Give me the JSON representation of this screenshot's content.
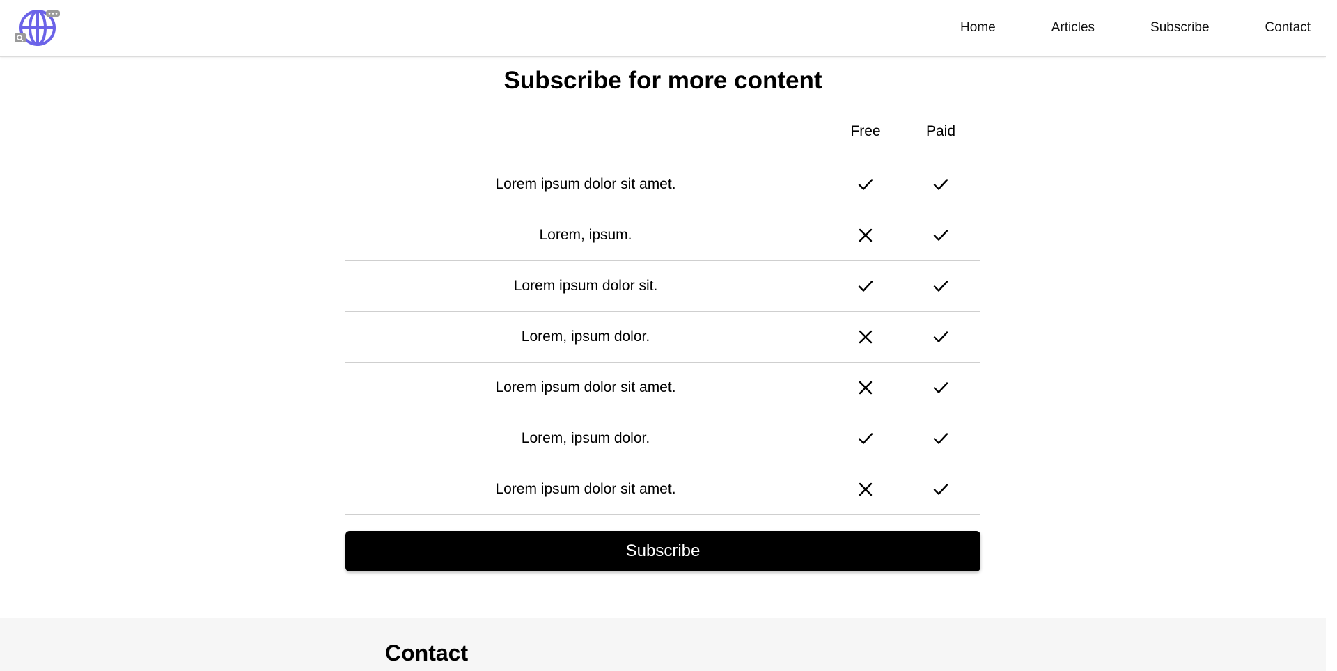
{
  "nav": {
    "items": [
      {
        "label": "Home"
      },
      {
        "label": "Articles"
      },
      {
        "label": "Subscribe"
      },
      {
        "label": "Contact"
      }
    ]
  },
  "logo": {
    "icon": "globe-icon",
    "color": "#6b63e8"
  },
  "subscribe_section": {
    "title": "Subscribe for more content",
    "columns": {
      "free": "Free",
      "paid": "Paid"
    },
    "rows": [
      {
        "feature": "Lorem ipsum dolor sit amet.",
        "free": true,
        "paid": true
      },
      {
        "feature": "Lorem, ipsum.",
        "free": false,
        "paid": true
      },
      {
        "feature": "Lorem ipsum dolor sit.",
        "free": true,
        "paid": true
      },
      {
        "feature": "Lorem, ipsum dolor.",
        "free": false,
        "paid": true
      },
      {
        "feature": "Lorem ipsum dolor sit amet.",
        "free": false,
        "paid": true
      },
      {
        "feature": "Lorem, ipsum dolor.",
        "free": true,
        "paid": true
      },
      {
        "feature": "Lorem ipsum dolor sit amet.",
        "free": false,
        "paid": true
      }
    ],
    "button_label": "Subscribe"
  },
  "contact_section": {
    "title": "Contact"
  },
  "colors": {
    "accent": "#000000",
    "button_text": "#ffffff",
    "divider": "#cfcfcf",
    "footer_bg": "#f6f6f6"
  }
}
